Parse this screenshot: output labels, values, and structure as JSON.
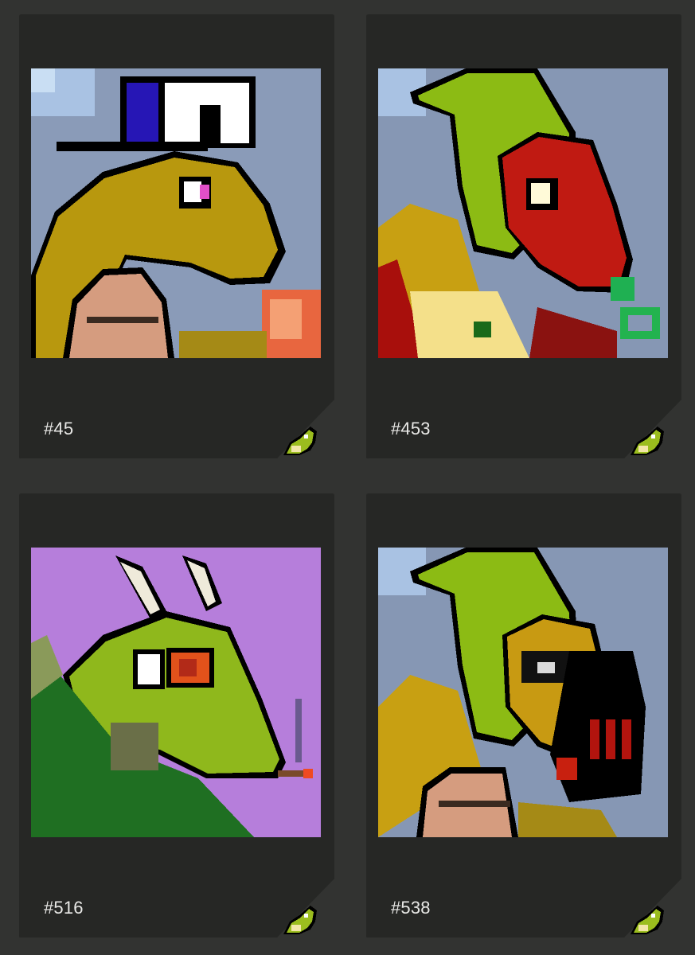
{
  "items": [
    {
      "label": "#45"
    },
    {
      "label": "#453"
    },
    {
      "label": "#516"
    },
    {
      "label": "#538"
    }
  ],
  "colors": {
    "page_background": "#323331",
    "card_background": "#262725",
    "label_text": "#e9e9e7"
  },
  "icons": {
    "corner": "dragon-mascot-icon"
  }
}
